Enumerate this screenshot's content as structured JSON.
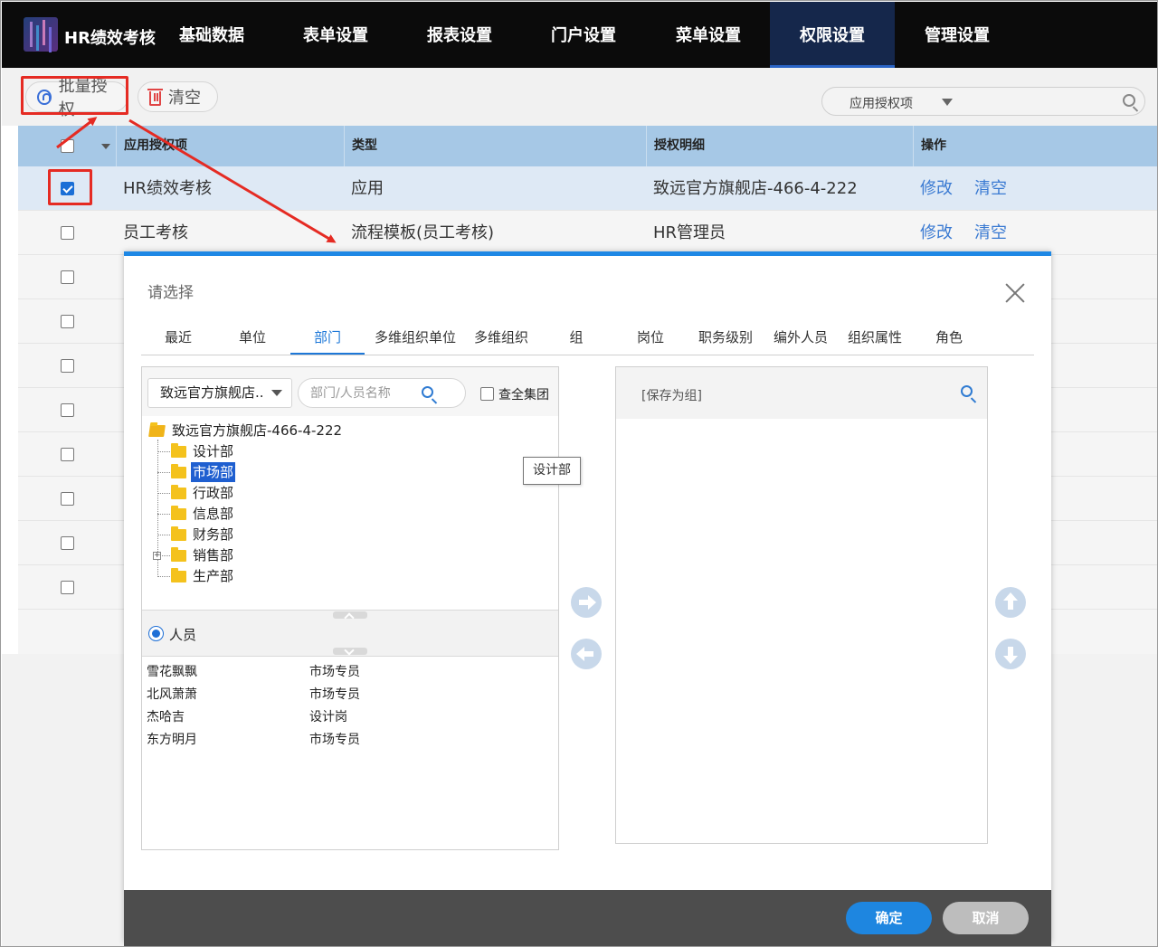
{
  "nav": {
    "brand": "HR绩效考核",
    "items": [
      {
        "label": "基础数据"
      },
      {
        "label": "表单设置"
      },
      {
        "label": "报表设置"
      },
      {
        "label": "门户设置"
      },
      {
        "label": "菜单设置"
      },
      {
        "label": "权限设置",
        "active": true
      },
      {
        "label": "管理设置"
      }
    ]
  },
  "toolbar": {
    "batch_auth_label": "批量授权",
    "clear_label": "清空",
    "search_select": "应用授权项"
  },
  "table": {
    "headers": {
      "col1": "应用授权项",
      "col2": "类型",
      "col3": "授权明细",
      "col4": "操作"
    },
    "rows": [
      {
        "name": "HR绩效考核",
        "type": "应用",
        "detail": "致远官方旗舰店-466-4-222",
        "edit": "修改",
        "clear": "清空",
        "checked": true
      },
      {
        "name": "员工考核",
        "type": "流程模板(员工考核)",
        "detail": "HR管理员",
        "edit": "修改",
        "clear": "清空",
        "checked": false
      }
    ]
  },
  "dialog": {
    "title": "请选择",
    "tabs": [
      {
        "label": "最近"
      },
      {
        "label": "单位"
      },
      {
        "label": "部门",
        "active": true
      },
      {
        "label": "多维组织单位"
      },
      {
        "label": "多维组织"
      },
      {
        "label": "组"
      },
      {
        "label": "岗位"
      },
      {
        "label": "职务级别"
      },
      {
        "label": "编外人员"
      },
      {
        "label": "组织属性"
      },
      {
        "label": "角色"
      }
    ],
    "left": {
      "unit_select": "致远官方旗舰店..",
      "search_placeholder": "部门/人员名称",
      "search_all_label": "查全集团",
      "tree": {
        "root": "致远官方旗舰店-466-4-222",
        "children": [
          "设计部",
          "市场部",
          "行政部",
          "信息部",
          "财务部",
          "销售部",
          "生产部"
        ],
        "selected": "市场部"
      },
      "person_radio_label": "人员",
      "people": [
        {
          "name": "雪花飘飘",
          "post": "市场专员"
        },
        {
          "name": "北风萧萧",
          "post": "市场专员"
        },
        {
          "name": "杰哈吉",
          "post": "设计岗"
        },
        {
          "name": "东方明月",
          "post": "市场专员"
        }
      ]
    },
    "tooltip": "设计部",
    "right": {
      "save_group_label": "[保存为组]"
    },
    "confirm_label": "确定",
    "cancel_label": "取消"
  },
  "colors": {
    "nav_bg": "#0b0b0b",
    "nav_active": "#15274b",
    "table_header": "#a6c8e6",
    "dialog_accent": "#1e88e5",
    "annotation_red": "#e52b23",
    "link_blue": "#3a7ad2"
  }
}
